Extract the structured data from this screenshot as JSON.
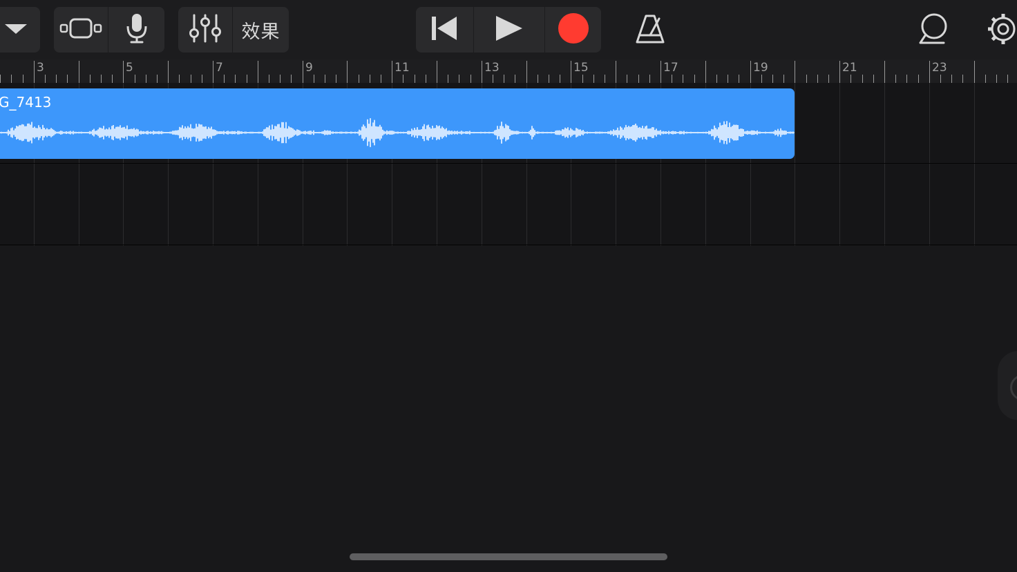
{
  "toolbar": {
    "effects_label": "效果"
  },
  "ruler": {
    "bar_numbers": [
      "3",
      "5",
      "7",
      "9",
      "11",
      "13",
      "15",
      "17",
      "19",
      "21",
      "23"
    ]
  },
  "track": {
    "region_name": "G_7413"
  },
  "colors": {
    "background": "#18181a",
    "toolbar": "#1c1c1e",
    "region": "#3d97fb",
    "waveform": "#cfe5ff",
    "record": "#ff3b30"
  },
  "icons": [
    "view-menu-chevron-icon",
    "track-view-icon",
    "microphone-icon",
    "mixer-sliders-icon",
    "go-to-start-icon",
    "play-icon",
    "record-icon",
    "metronome-icon",
    "loop-browser-icon",
    "settings-gear-icon"
  ]
}
